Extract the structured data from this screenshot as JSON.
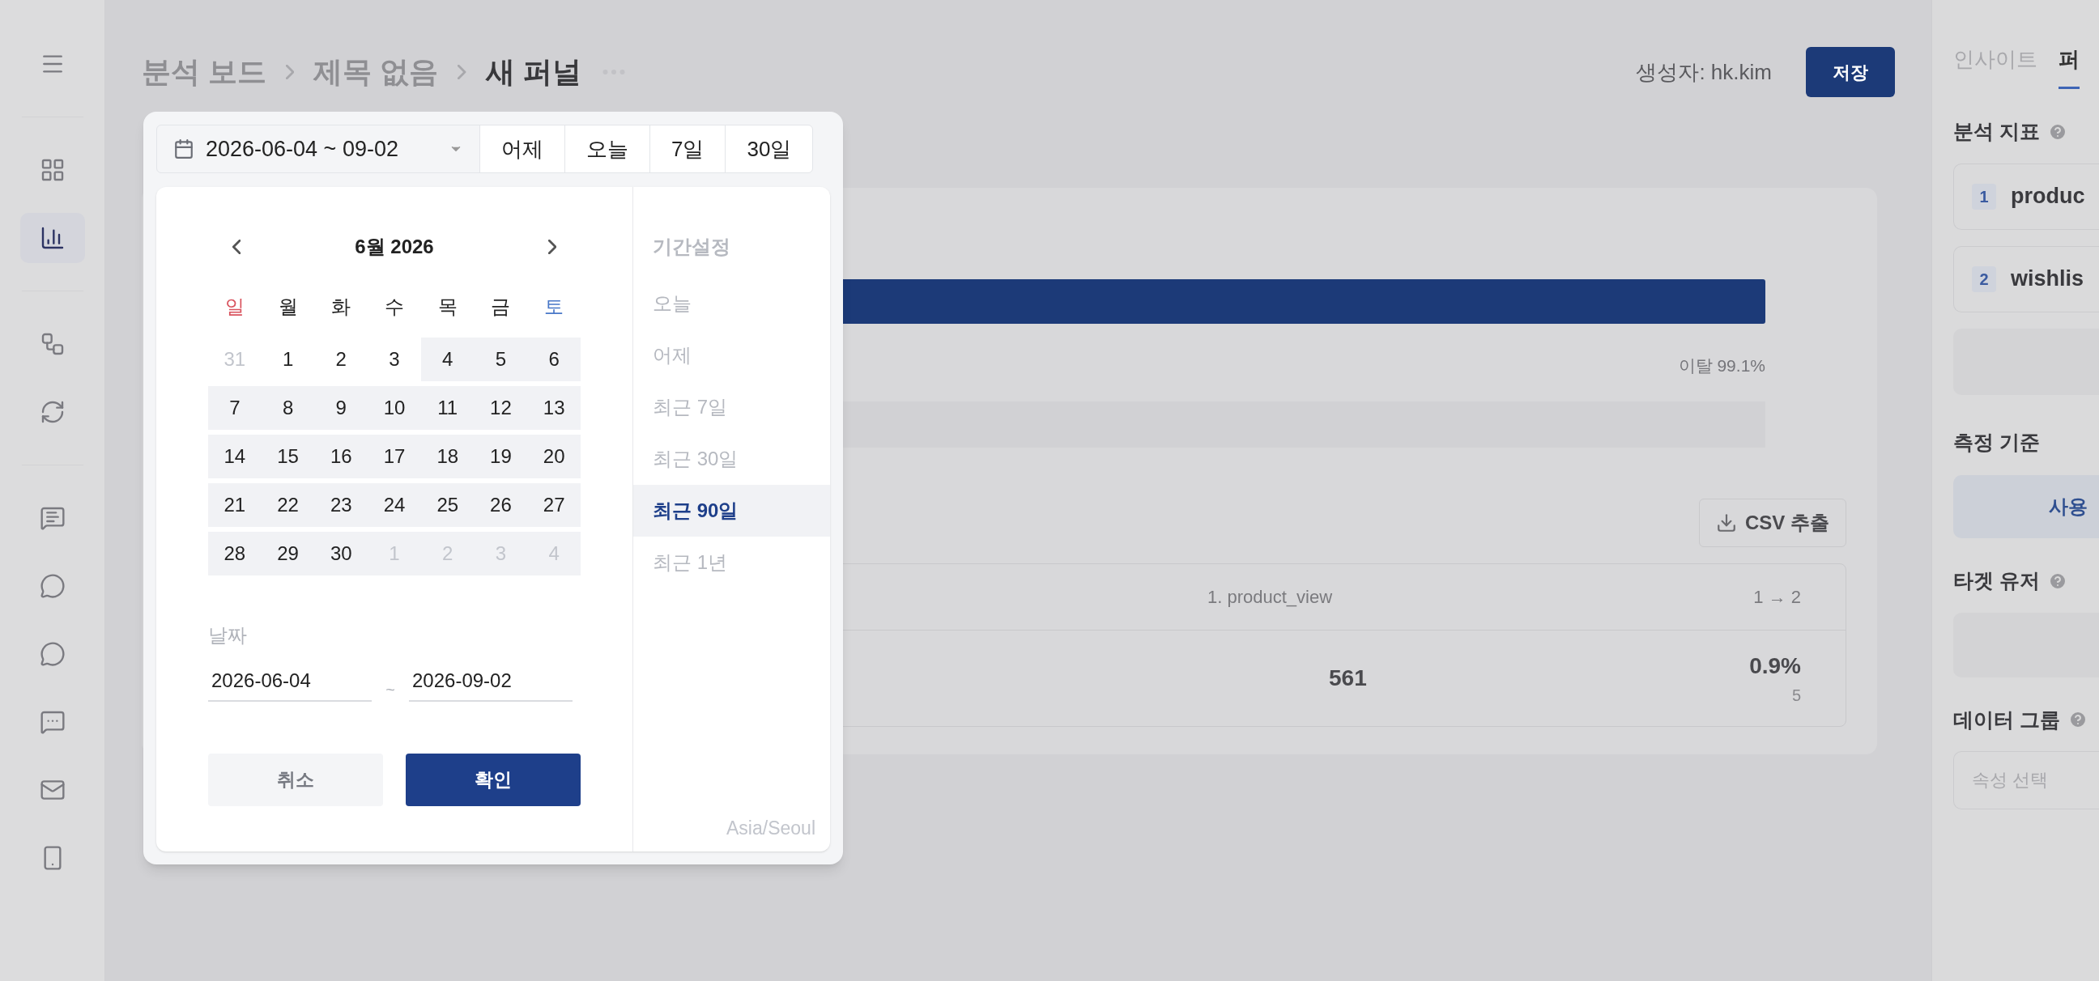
{
  "sidebar": {
    "items": [
      {
        "selected": false
      },
      {
        "selected": false
      },
      {
        "selected": true
      },
      {
        "selected": false
      },
      {
        "selected": false
      },
      {
        "selected": false
      },
      {
        "selected": false
      },
      {
        "selected": false
      },
      {
        "selected": false
      },
      {
        "selected": false
      },
      {
        "selected": false
      }
    ]
  },
  "header": {
    "breadcrumb": [
      "분석 보드",
      "제목 없음",
      "새 퍼널"
    ],
    "author": "생성자: hk.kim",
    "save_button": "저장"
  },
  "funnel": {
    "drop_label": "이탈 99.1%",
    "csv_button": "CSV 추출",
    "table": {
      "columns": [
        "1. product_view",
        "1 → 2"
      ],
      "rows": [
        {
          "count": "561",
          "rate": "0.9%",
          "rate_count": "5"
        }
      ]
    }
  },
  "date_picker": {
    "range_value": "2026-06-04 ~ 09-02",
    "quick_buttons": [
      "어제",
      "오늘",
      "7일",
      "30일"
    ],
    "calendar": {
      "month_title": "6월 2026",
      "weekdays": [
        {
          "label": "일",
          "kind": "sunday"
        },
        {
          "label": "월",
          "kind": "weekday"
        },
        {
          "label": "화",
          "kind": "weekday"
        },
        {
          "label": "수",
          "kind": "weekday"
        },
        {
          "label": "목",
          "kind": "weekday"
        },
        {
          "label": "금",
          "kind": "weekday"
        },
        {
          "label": "토",
          "kind": "saturday"
        }
      ],
      "weeks": [
        [
          {
            "label": "31",
            "outside": true,
            "in_range": false
          },
          {
            "label": "1",
            "outside": false,
            "in_range": false
          },
          {
            "label": "2",
            "outside": false,
            "in_range": false
          },
          {
            "label": "3",
            "outside": false,
            "in_range": false
          },
          {
            "label": "4",
            "outside": false,
            "in_range": true
          },
          {
            "label": "5",
            "outside": false,
            "in_range": true
          },
          {
            "label": "6",
            "outside": false,
            "in_range": true
          }
        ],
        [
          {
            "label": "7",
            "outside": false,
            "in_range": true
          },
          {
            "label": "8",
            "outside": false,
            "in_range": true
          },
          {
            "label": "9",
            "outside": false,
            "in_range": true
          },
          {
            "label": "10",
            "outside": false,
            "in_range": true
          },
          {
            "label": "11",
            "outside": false,
            "in_range": true
          },
          {
            "label": "12",
            "outside": false,
            "in_range": true
          },
          {
            "label": "13",
            "outside": false,
            "in_range": true
          }
        ],
        [
          {
            "label": "14",
            "outside": false,
            "in_range": true
          },
          {
            "label": "15",
            "outside": false,
            "in_range": true
          },
          {
            "label": "16",
            "outside": false,
            "in_range": true
          },
          {
            "label": "17",
            "outside": false,
            "in_range": true
          },
          {
            "label": "18",
            "outside": false,
            "in_range": true
          },
          {
            "label": "19",
            "outside": false,
            "in_range": true
          },
          {
            "label": "20",
            "outside": false,
            "in_range": true
          }
        ],
        [
          {
            "label": "21",
            "outside": false,
            "in_range": true
          },
          {
            "label": "22",
            "outside": false,
            "in_range": true
          },
          {
            "label": "23",
            "outside": false,
            "in_range": true
          },
          {
            "label": "24",
            "outside": false,
            "in_range": true
          },
          {
            "label": "25",
            "outside": false,
            "in_range": true
          },
          {
            "label": "26",
            "outside": false,
            "in_range": true
          },
          {
            "label": "27",
            "outside": false,
            "in_range": true
          }
        ],
        [
          {
            "label": "28",
            "outside": false,
            "in_range": true
          },
          {
            "label": "29",
            "outside": false,
            "in_range": true
          },
          {
            "label": "30",
            "outside": false,
            "in_range": true
          },
          {
            "label": "1",
            "outside": true,
            "in_range": true
          },
          {
            "label": "2",
            "outside": true,
            "in_range": true
          },
          {
            "label": "3",
            "outside": true,
            "in_range": true
          },
          {
            "label": "4",
            "outside": true,
            "in_range": true
          }
        ]
      ]
    },
    "date_fields": {
      "label": "날짜",
      "start": "2026-06-04",
      "separator": "~",
      "end": "2026-09-02"
    },
    "cancel_button": "취소",
    "confirm_button": "확인",
    "presets": {
      "title": "기간설정",
      "items": [
        {
          "label": "오늘",
          "selected": false
        },
        {
          "label": "어제",
          "selected": false
        },
        {
          "label": "최근 7일",
          "selected": false
        },
        {
          "label": "최근 30일",
          "selected": false
        },
        {
          "label": "최근 90일",
          "selected": true
        },
        {
          "label": "최근 1년",
          "selected": false
        }
      ],
      "timezone": "Asia/Seoul"
    }
  },
  "right_panel": {
    "tabs": [
      {
        "label": "인사이트",
        "selected": false
      },
      {
        "label": "퍼",
        "selected": true
      }
    ],
    "metrics_title": "분석 지표",
    "metrics": [
      {
        "index": "1",
        "name": "produc"
      },
      {
        "index": "2",
        "name": "wishlis"
      }
    ],
    "measure_title": "측정 기준",
    "measure_button": "사용",
    "target_title": "타겟 유저",
    "group_title": "데이터 그룹",
    "group_placeholder": "속성 선택"
  }
}
